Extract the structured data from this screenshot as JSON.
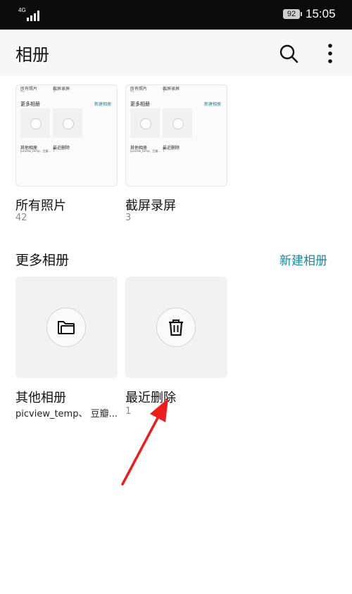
{
  "status_bar": {
    "network": "4G",
    "battery": "92",
    "time": "15:05"
  },
  "app_bar": {
    "title": "相册"
  },
  "albums_top": [
    {
      "name": "所有照片",
      "count": "42"
    },
    {
      "name": "截屏录屏",
      "count": "3"
    }
  ],
  "preview": {
    "row1_a": "所有照片",
    "row1_a_count": "41",
    "row1_b": "截屏录屏",
    "row1_b_count": "3",
    "section_title": "更多相册",
    "new_album": "新建相册",
    "cap_a": "其他相册",
    "sub_a": "picview_temp、豆瓣…",
    "cap_b": "最近删除",
    "sub_b": "7"
  },
  "more_albums": {
    "title": "更多相册",
    "new_album": "新建相册",
    "items": [
      {
        "name": "其他相册",
        "detail": "picview_temp、 豆瓣...",
        "icon": "folder-icon"
      },
      {
        "name": "最近删除",
        "detail": "1",
        "icon": "trash-icon"
      }
    ]
  },
  "colors": {
    "accent": "#138b9b",
    "annotation_arrow": "#ee1c1c"
  }
}
